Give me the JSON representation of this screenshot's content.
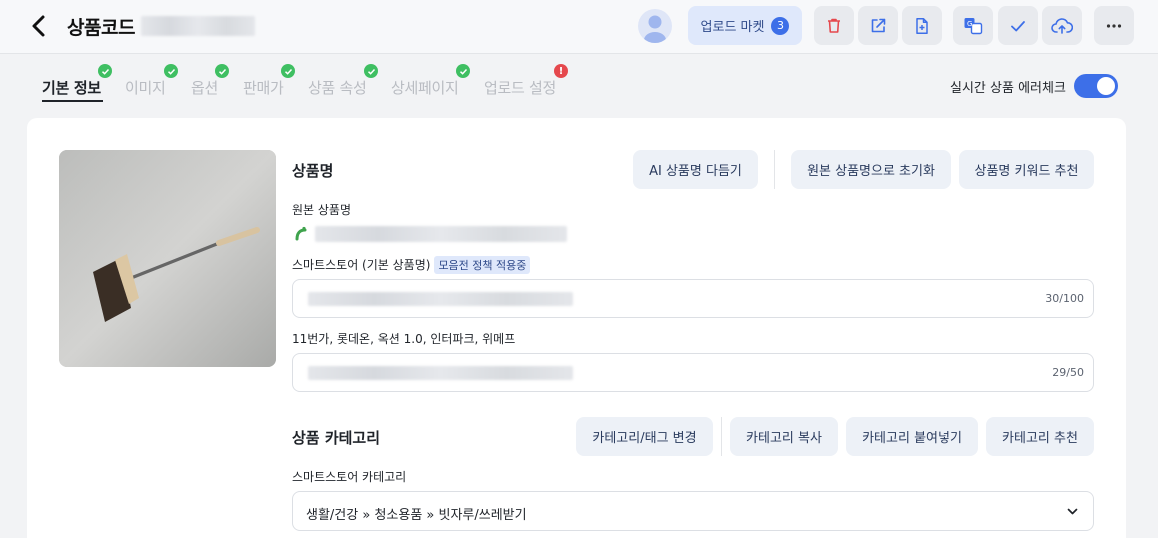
{
  "header": {
    "title": "상품코드",
    "upload_market_label": "업로드 마켓",
    "upload_market_count": "3",
    "tools": [
      "trash-icon",
      "external-link-icon",
      "file-add-icon",
      "translate-icon",
      "check-icon",
      "cloud-upload-icon",
      "more-icon"
    ]
  },
  "tabs": [
    {
      "label": "기본 정보",
      "status": "ok",
      "active": true
    },
    {
      "label": "이미지",
      "status": "ok"
    },
    {
      "label": "옵션",
      "status": "ok"
    },
    {
      "label": "판매가",
      "status": "ok"
    },
    {
      "label": "상품 속성",
      "status": "ok"
    },
    {
      "label": "상세페이지",
      "status": "ok"
    },
    {
      "label": "업로드 설정",
      "status": "error",
      "error_mark": "!"
    }
  ],
  "realtime_check": {
    "label": "실시간 상품 에러체크",
    "enabled": true
  },
  "product_name": {
    "title": "상품명",
    "buttons": {
      "ai": "AI 상품명 다듬기",
      "reset": "원본 상품명으로 초기화",
      "keyword": "상품명 키워드 추천"
    },
    "original_label": "원본 상품명",
    "smartstore_label": "스마트스토어 (기본 상품명)",
    "policy_tag": "모음전 정책 적용중",
    "smartstore_counter": "30/100",
    "others_label": "11번가, 롯데온, 옥션 1.0, 인터파크, 위메프",
    "others_counter": "29/50"
  },
  "category": {
    "title": "상품 카테고리",
    "buttons": {
      "change": "카테고리/태그 변경",
      "copy": "카테고리 복사",
      "paste": "카테고리 붙여넣기",
      "recommend": "카테고리 추천"
    },
    "smartstore_label": "스마트스토어 카테고리",
    "selected": "생활/건강 » 청소용품 » 빗자루/쓰레받기"
  },
  "colors": {
    "accent": "#3d6fe8",
    "success": "#3fbf62",
    "error": "#e5484d"
  }
}
